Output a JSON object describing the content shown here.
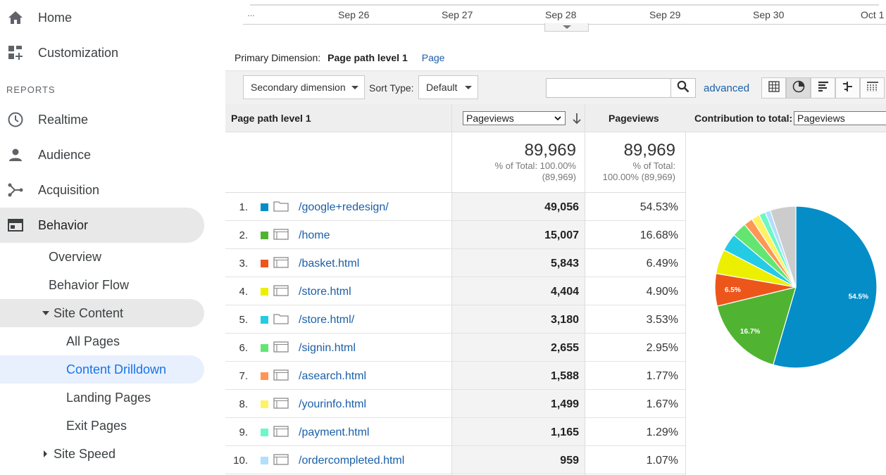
{
  "sidebar": {
    "home": "Home",
    "customization": "Customization",
    "reports_label": "REPORTS",
    "realtime": "Realtime",
    "audience": "Audience",
    "acquisition": "Acquisition",
    "behavior": "Behavior",
    "overview": "Overview",
    "behavior_flow": "Behavior Flow",
    "site_content": "Site Content",
    "all_pages": "All Pages",
    "content_drilldown": "Content Drilldown",
    "landing_pages": "Landing Pages",
    "exit_pages": "Exit Pages",
    "site_speed": "Site Speed"
  },
  "timeline": {
    "ellipsis": "…",
    "ticks": [
      "Sep 26",
      "Sep 27",
      "Sep 28",
      "Sep 29",
      "Sep 30",
      "Oct 1"
    ]
  },
  "primary_dimension": {
    "label": "Primary Dimension:",
    "current": "Page path level 1",
    "alternate": "Page"
  },
  "toolbar": {
    "secondary_dimension": "Secondary dimension",
    "sort_type_label": "Sort Type:",
    "sort_type_value": "Default",
    "search_value": "",
    "advanced": "advanced"
  },
  "table": {
    "col_dimension": "Page path level 1",
    "col_metric_select": "Pageviews",
    "col_pageviews": "Pageviews",
    "contribution_label": "Contribution to total:",
    "contribution_select": "Pageviews",
    "totals": {
      "value_1": "89,969",
      "pct_line_1": "% of Total: 100.00%",
      "pct_line_1b": "(89,969)",
      "value_2": "89,969",
      "pct_line_2": "% of Total:",
      "pct_line_2b": "100.00% (89,969)"
    },
    "rows": [
      {
        "idx": "1.",
        "path": "/google+redesign/",
        "pageviews": "49,056",
        "pct": "54.53%",
        "color": "#058dc7",
        "icon": "folder-icon"
      },
      {
        "idx": "2.",
        "path": "/home",
        "pageviews": "15,007",
        "pct": "16.68%",
        "color": "#50b432",
        "icon": "page-icon"
      },
      {
        "idx": "3.",
        "path": "/basket.html",
        "pageviews": "5,843",
        "pct": "6.49%",
        "color": "#ed561b",
        "icon": "page-icon"
      },
      {
        "idx": "4.",
        "path": "/store.html",
        "pageviews": "4,404",
        "pct": "4.90%",
        "color": "#edef00",
        "icon": "page-icon"
      },
      {
        "idx": "5.",
        "path": "/store.html/",
        "pageviews": "3,180",
        "pct": "3.53%",
        "color": "#24cbe5",
        "icon": "folder-icon"
      },
      {
        "idx": "6.",
        "path": "/signin.html",
        "pageviews": "2,655",
        "pct": "2.95%",
        "color": "#64e572",
        "icon": "page-icon"
      },
      {
        "idx": "7.",
        "path": "/asearch.html",
        "pageviews": "1,588",
        "pct": "1.77%",
        "color": "#ff9655",
        "icon": "page-icon"
      },
      {
        "idx": "8.",
        "path": "/yourinfo.html",
        "pageviews": "1,499",
        "pct": "1.67%",
        "color": "#fff263",
        "icon": "page-icon"
      },
      {
        "idx": "9.",
        "path": "/payment.html",
        "pageviews": "1,165",
        "pct": "1.29%",
        "color": "#6af9c4",
        "icon": "page-icon"
      },
      {
        "idx": "10.",
        "path": "/ordercompleted.html",
        "pageviews": "959",
        "pct": "1.07%",
        "color": "#b2deff",
        "icon": "page-icon"
      }
    ]
  },
  "chart_data": {
    "type": "pie",
    "slices": [
      54.53,
      16.68,
      6.49,
      4.9,
      3.53,
      2.95,
      1.77,
      1.67,
      1.29,
      1.07,
      5.12
    ],
    "colors": [
      "#058dc7",
      "#50b432",
      "#ed561b",
      "#edef00",
      "#24cbe5",
      "#64e572",
      "#ff9655",
      "#fff263",
      "#6af9c4",
      "#b2deff",
      "#cccccc"
    ],
    "labels": [
      "54.5%",
      "16.7%",
      "6.5%",
      "",
      "",
      "",
      "",
      "",
      "",
      "",
      ""
    ]
  }
}
